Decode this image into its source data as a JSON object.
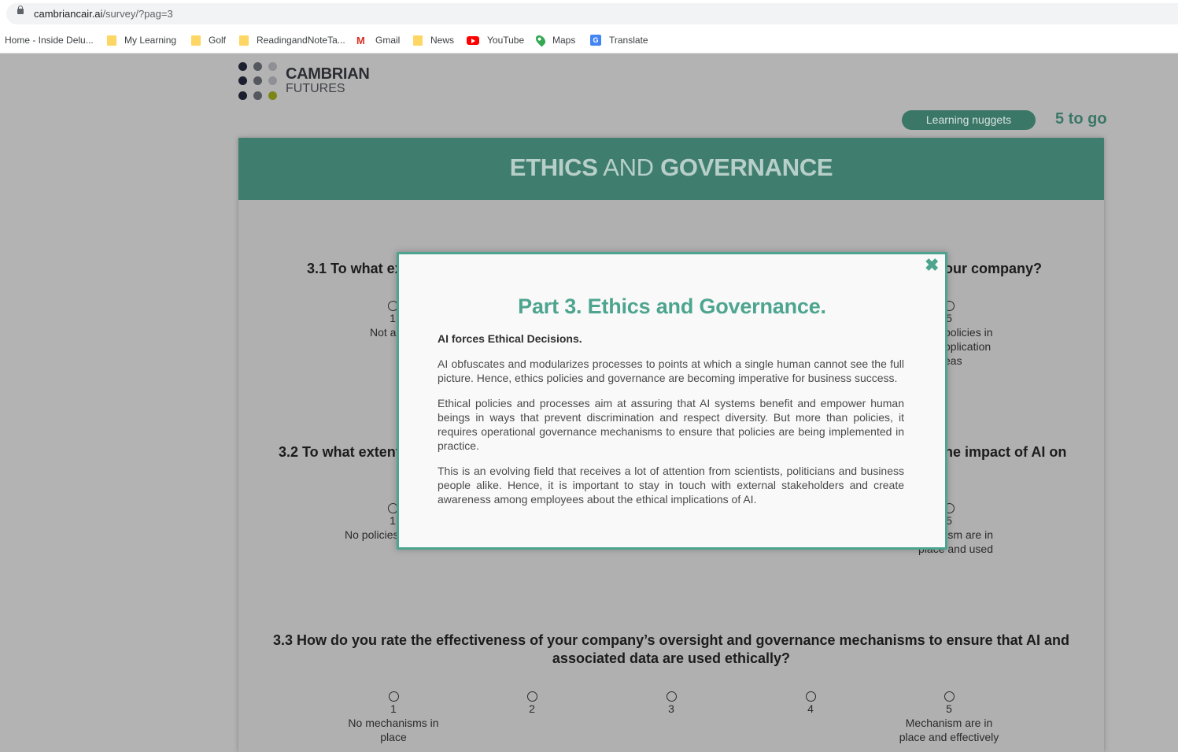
{
  "browser": {
    "url_domain": "cambriancair.ai",
    "url_path": "/survey/?pag=3",
    "bookmarks": [
      {
        "label": "Home - Inside Delu...",
        "icon": "none"
      },
      {
        "label": "My Learning",
        "icon": "folder-icon"
      },
      {
        "label": "Golf",
        "icon": "folder-icon"
      },
      {
        "label": "ReadingandNoteTa...",
        "icon": "folder-icon"
      },
      {
        "label": "Gmail",
        "icon": "gmail-icon"
      },
      {
        "label": "News",
        "icon": "folder-icon"
      },
      {
        "label": "YouTube",
        "icon": "youtube-icon"
      },
      {
        "label": "Maps",
        "icon": "maps-icon"
      },
      {
        "label": "Translate",
        "icon": "translate-icon"
      }
    ]
  },
  "logo": {
    "line1": "CAMBRIAN",
    "line2": "FUTURES"
  },
  "header": {
    "nuggets_label": "Learning nuggets",
    "remaining": "5 to go"
  },
  "section": {
    "title_part1": "ETHICS",
    "title_and": "AND",
    "title_part2": "GOVERNANCE"
  },
  "questions": {
    "q1": {
      "left": "3.1 To what ex",
      "right": "our company?",
      "opt1_num": "1",
      "opt1_label": "Not a",
      "opt5_num": "5",
      "opt5_label_l1": "policies in",
      "opt5_label_l2": "pplication",
      "opt5_label_l3": "eas"
    },
    "q2": {
      "left": "3.2 To what extent",
      "right": "he impact of AI on",
      "opt1_num": "1",
      "opt1_label": "No policies",
      "opt5_num": "5",
      "opt5_label_l1": "sm are in",
      "opt5_label_l2": "place and used"
    },
    "q3": {
      "text": "3.3 How do you rate the effectiveness of your company’s oversight and governance mechanisms to ensure that AI and associated data are used ethically?",
      "options": [
        "1",
        "2",
        "3",
        "4",
        "5"
      ],
      "opt1_label": "No mechanisms in place",
      "opt5_label": "Mechanism are in place and effectively"
    }
  },
  "modal": {
    "close": "✖",
    "title": "Part 3. Ethics and Governance.",
    "subtitle": "AI forces Ethical Decisions.",
    "p1": "AI obfuscates and modularizes processes to points at which a single human cannot see the full picture. Hence, ethics policies and governance are becoming imperative for business success.",
    "p2": "Ethical policies and processes aim at assuring that AI systems benefit and empower human beings in ways that prevent discrimination and respect diversity. But more than policies, it requires operational governance mechanisms to ensure that policies are being implemented in practice.",
    "p3": "This is an evolving field that receives a lot of attention from scientists, politicians and business people alike. Hence, it is important to stay in touch with external stakeholders and create awareness among employees about the ethical implications of AI."
  },
  "colors": {
    "brand_green": "#3f7e6e",
    "modal_accent": "#4ea58f",
    "overlay": "#b3b3b3"
  }
}
